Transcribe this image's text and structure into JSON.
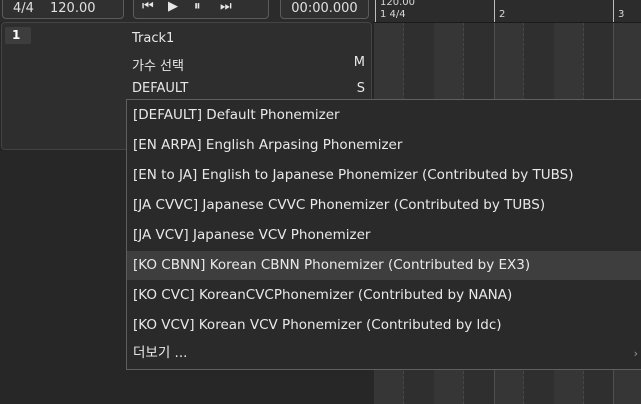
{
  "toolbar": {
    "time_signature": "4/4",
    "bpm": "120.00",
    "transport": {
      "skip_back": "⏮",
      "play": "▶",
      "pause": "⏸",
      "skip_forward": "⏭"
    },
    "timecode": "00:00.000"
  },
  "ruler": {
    "tempo": "120.00",
    "bar1": "1 4/4",
    "bar2": "2",
    "bar3": "3"
  },
  "track": {
    "number": "1",
    "name": "Track1",
    "singer_label": "가수 선택",
    "mute_key": "M",
    "phonemizer_label": "DEFAULT",
    "solo_key": "S"
  },
  "phonemizer_menu": {
    "items": [
      "[DEFAULT] Default Phonemizer",
      "[EN ARPA] English Arpasing Phonemizer",
      "[EN to JA] English to Japanese Phonemizer (Contributed by TUBS)",
      "[JA CVVC] Japanese CVVC Phonemizer (Contributed by TUBS)",
      "[JA VCV] Japanese VCV Phonemizer",
      "[KO CBNN] Korean CBNN Phonemizer (Contributed by EX3)",
      "[KO CVC] KoreanCVCPhonemizer (Contributed by NANA)",
      "[KO VCV] Korean VCV Phonemizer (Contributed by ldc)",
      "더보기 ..."
    ],
    "highlighted_index": 5
  },
  "icons": {
    "skip_back": "skip-back-icon",
    "play": "play-icon",
    "pause": "pause-icon",
    "skip_forward": "skip-forward-icon",
    "submenu": "chevron-right-icon"
  },
  "colors": {
    "background": "#252525",
    "menu_background": "#2a2a2a",
    "highlight": "#3e3e3e",
    "text": "#e6e6e6"
  }
}
